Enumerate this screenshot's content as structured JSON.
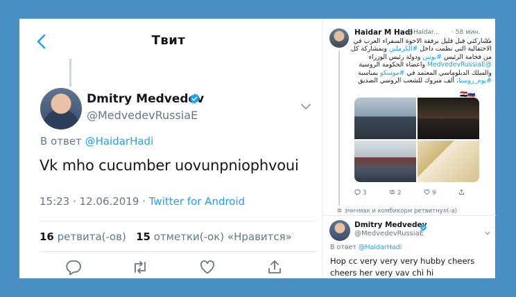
{
  "header": {
    "title": "Твит"
  },
  "main_tweet": {
    "author_name": "Dmitry Medvedev",
    "author_handle": "@MedvedevRussiaE",
    "reply_prefix": "В ответ",
    "reply_handle": "@HaidarHadi",
    "text": "Vk mho cucumber uovunpniophvoui",
    "time": "15:23",
    "date": "12.06.2019",
    "source": "Twitter for Android",
    "retweets_count": "16",
    "retweets_label": "ретвита(-ов)",
    "likes_count": "15",
    "likes_label": "отметки(-ок) «Нравится»"
  },
  "side_tweet": {
    "author_name": "Haidar M Hadi",
    "author_handle": "@Haidar...",
    "time": "· 58 мин.",
    "text_a": "مشاركتي قبل قليل برفقة الاخوة السفراء العرب في الاحتفالية التي نظمت داخل ",
    "tag_kremlin": "#الكرملين",
    "text_b": " وبمشاركة كل من فخامة الرئيس ",
    "tag_putin": "#بوتين",
    "text_c": " ودولة رئيس الوزراء ",
    "mention_medvedev": "@MedvedevRussiaE",
    "text_d": " واعضاء الحكومة الروسية والسلك الدبلوماسي المعتمد في ",
    "tag_moscow": "#موسكو",
    "text_e": " بمناسبة ",
    "tag_russia_day": "#يوم_روسيا",
    "text_f": ". ألف مبروك للشعب الروسي الصديق",
    "flags": "🇮🇶🇷🇺",
    "replies": "3",
    "retweets": "2",
    "likes": "9",
    "retweeted_note": "эчнчмак и комбикорм ретвитнул(-а)"
  },
  "side_reply": {
    "author_name": "Dmitry Medvedev",
    "author_handle": "@MedvedevRussiaE",
    "reply_prefix": "В ответ",
    "reply_handle": "@HaidarHadi",
    "text": "Hop cc very very very hubby cheers cheers her very vav chi hi"
  },
  "colors": {
    "accent": "#1da1f2",
    "background": "#4a90c4",
    "muted": "#657786"
  }
}
